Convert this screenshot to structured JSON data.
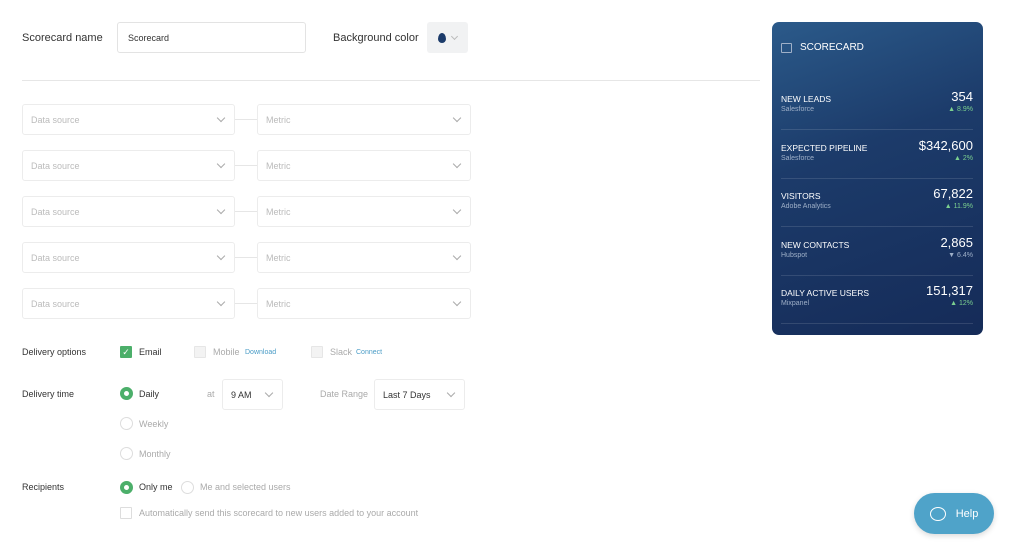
{
  "form": {
    "name_label": "Scorecard name",
    "name_value": "Scorecard",
    "bg_label": "Background color"
  },
  "metrics_rows": [
    {
      "source": "Data source",
      "metric": "Metric"
    },
    {
      "source": "Data source",
      "metric": "Metric"
    },
    {
      "source": "Data source",
      "metric": "Metric"
    },
    {
      "source": "Data source",
      "metric": "Metric"
    },
    {
      "source": "Data source",
      "metric": "Metric"
    }
  ],
  "delivery": {
    "options_label": "Delivery options",
    "email": "Email",
    "mobile": "Mobile",
    "mobile_link": "Download",
    "slack": "Slack",
    "slack_link": "Connect",
    "time_label": "Delivery time",
    "daily": "Daily",
    "weekly": "Weekly",
    "monthly": "Monthly",
    "at": "at",
    "time_value": "9 AM",
    "range_label": "Date Range",
    "range_value": "Last 7 Days"
  },
  "recipients": {
    "label": "Recipients",
    "only_me": "Only me",
    "selected": "Me and selected users",
    "auto": "Automatically send this scorecard to new users added to your account"
  },
  "card": {
    "title": "SCORECARD",
    "rows": [
      {
        "name": "NEW LEADS",
        "source": "Salesforce",
        "value": "354",
        "change": "▲ 8.9%"
      },
      {
        "name": "EXPECTED PIPELINE",
        "source": "Salesforce",
        "value": "$342,600",
        "change": "▲ 2%"
      },
      {
        "name": "VISITORS",
        "source": "Adobe Analytics",
        "value": "67,822",
        "change": "▲ 11.9%"
      },
      {
        "name": "NEW CONTACTS",
        "source": "Hubspot",
        "value": "2,865",
        "change": "▼ 6.4%"
      },
      {
        "name": "DAILY ACTIVE USERS",
        "source": "Mixpanel",
        "value": "151,317",
        "change": "▲ 12%"
      }
    ]
  },
  "help": {
    "label": "Help"
  },
  "colors": {
    "accent": "#4caf6a",
    "card_bg": "#1c3b6a",
    "help": "#4fa3c9"
  }
}
